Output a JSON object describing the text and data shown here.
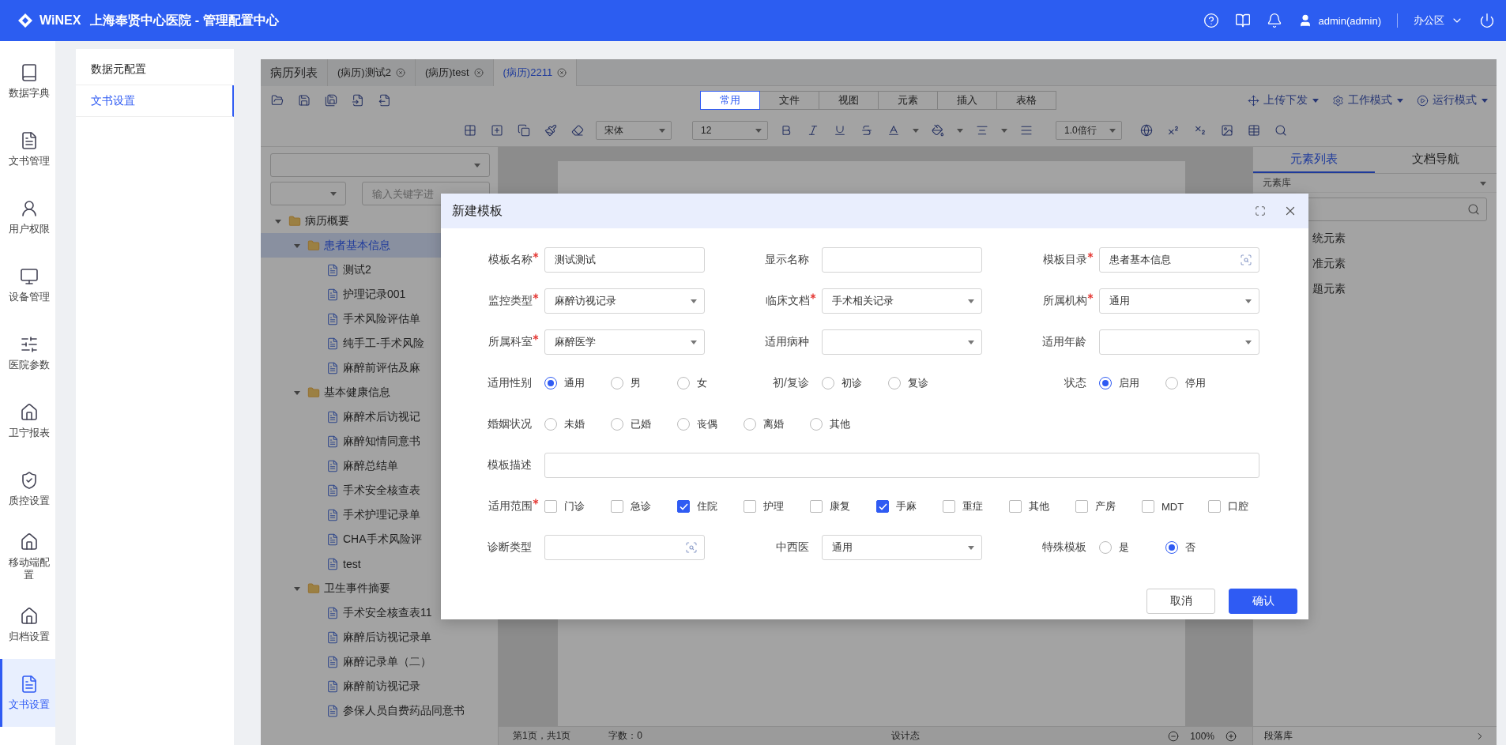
{
  "header": {
    "logo": "WiNEX",
    "title": "上海奉贤中心医院 - 管理配置中心",
    "user": "admin(admin)",
    "workspace": "办公区"
  },
  "rail": [
    {
      "label": "数据字典",
      "kind": "book",
      "selected": false
    },
    {
      "label": "文书管理",
      "kind": "file",
      "selected": false
    },
    {
      "label": "用户权限",
      "kind": "user",
      "selected": false
    },
    {
      "label": "设备管理",
      "kind": "monitor",
      "selected": false
    },
    {
      "label": "医院参数",
      "kind": "sliders",
      "selected": false
    },
    {
      "label": "卫宁报表",
      "kind": "house",
      "selected": false
    },
    {
      "label": "质控设置",
      "kind": "shield",
      "selected": false
    },
    {
      "label": "移动端配置",
      "kind": "house",
      "selected": false
    },
    {
      "label": "归档设置",
      "kind": "house",
      "selected": false
    },
    {
      "label": "文书设置",
      "kind": "file",
      "selected": true
    }
  ],
  "submenu": [
    {
      "label": "数据元配置",
      "selected": false
    },
    {
      "label": "文书设置",
      "selected": true
    }
  ],
  "doc_tabs": [
    {
      "label": "病历列表",
      "closable": false,
      "selected": false
    },
    {
      "label": "(病历)测试2",
      "closable": true,
      "selected": false
    },
    {
      "label": "(病历)test",
      "closable": true,
      "selected": false
    },
    {
      "label": "(病历)2211",
      "closable": true,
      "selected": true
    }
  ],
  "ribbon_tabs": [
    {
      "label": "常用",
      "selected": true
    },
    {
      "label": "文件",
      "selected": false
    },
    {
      "label": "视图",
      "selected": false
    },
    {
      "label": "元素",
      "selected": false
    },
    {
      "label": "插入",
      "selected": false
    },
    {
      "label": "表格",
      "selected": false
    }
  ],
  "ribbon_menus": [
    {
      "label": "上传下发",
      "kind": "move"
    },
    {
      "label": "工作模式",
      "kind": "gear"
    },
    {
      "label": "运行模式",
      "kind": "play"
    }
  ],
  "format": {
    "font": "宋体",
    "size": "12",
    "line_spacing": "1.0倍行"
  },
  "tree_filter": {
    "placeholder": "输入关键字进"
  },
  "tree": [
    {
      "label": "病历概要",
      "kind": "folder",
      "expanded": true,
      "selected": false,
      "children": [
        {
          "label": "患者基本信息",
          "kind": "folder",
          "expanded": true,
          "selected": true,
          "children": [
            {
              "label": "测试2",
              "kind": "document",
              "selected": false
            },
            {
              "label": "护理记录001",
              "kind": "document",
              "selected": false
            },
            {
              "label": "手术风险评估单",
              "kind": "document",
              "selected": false
            },
            {
              "label": "纯手工-手术风险",
              "kind": "document",
              "selected": false
            },
            {
              "label": "麻醉前评估及麻",
              "kind": "document",
              "selected": false
            }
          ]
        },
        {
          "label": "基本健康信息",
          "kind": "folder",
          "expanded": true,
          "selected": false,
          "children": [
            {
              "label": "麻醉术后访视记",
              "kind": "document",
              "selected": false
            },
            {
              "label": "麻醉知情同意书",
              "kind": "document",
              "selected": false
            },
            {
              "label": "麻醉总结单",
              "kind": "document",
              "selected": false
            },
            {
              "label": "手术安全核查表",
              "kind": "document",
              "selected": false
            },
            {
              "label": "手术护理记录单",
              "kind": "document",
              "selected": false
            },
            {
              "label": "CHA手术风险评",
              "kind": "document",
              "selected": false
            },
            {
              "label": "test",
              "kind": "document",
              "selected": false
            }
          ]
        },
        {
          "label": "卫生事件摘要",
          "kind": "folder",
          "expanded": true,
          "selected": false,
          "children": [
            {
              "label": "手术安全核查表11",
              "kind": "document",
              "selected": false
            },
            {
              "label": "麻醉后访视记录单",
              "kind": "document",
              "selected": false
            },
            {
              "label": "麻醉记录单（二）",
              "kind": "document",
              "selected": false
            },
            {
              "label": "麻醉前访视记录",
              "kind": "document",
              "selected": false
            },
            {
              "label": "参保人员自费药品同意书",
              "kind": "document",
              "selected": false
            }
          ]
        }
      ]
    }
  ],
  "side_tabs": [
    {
      "label": "元素列表",
      "selected": true
    },
    {
      "label": "文档导航",
      "selected": false
    }
  ],
  "element_library": "元素库",
  "elements": [
    "统元素",
    "准元素",
    "题元素"
  ],
  "status_bar": {
    "page": "第1页，共1页",
    "words": "字数：0",
    "mode": "设计态",
    "zoom": "100%",
    "paragraph_library": "段落库"
  },
  "dialog": {
    "title": "新建模板",
    "fields": [
      {
        "label": "模板名称",
        "kind": "text",
        "required": true,
        "value": "测试测试"
      },
      {
        "label": "显示名称",
        "kind": "text",
        "required": false
      },
      {
        "label": "模板目录",
        "kind": "lookup",
        "required": true,
        "value": "患者基本信息"
      },
      {
        "label": "监控类型",
        "kind": "select",
        "required": true,
        "value": "麻醉访视记录"
      },
      {
        "label": "临床文档",
        "kind": "select",
        "required": true,
        "value": "手术相关记录"
      },
      {
        "label": "所属机构",
        "kind": "select",
        "required": true,
        "value": "通用"
      },
      {
        "label": "所属科室",
        "kind": "select",
        "required": true,
        "value": "麻醉医学"
      },
      {
        "label": "适用病种",
        "kind": "select",
        "required": false
      },
      {
        "label": "适用年龄",
        "kind": "select",
        "required": false
      },
      {
        "label": "适用性别",
        "kind": "radio",
        "required": false,
        "options": [
          {
            "label": "通用",
            "selected": true
          },
          {
            "label": "男",
            "selected": false
          },
          {
            "label": "女",
            "selected": false
          }
        ]
      },
      {
        "label": "初/复诊",
        "kind": "radio",
        "required": false,
        "options": [
          {
            "label": "初诊",
            "selected": false
          },
          {
            "label": "复诊",
            "selected": false
          }
        ]
      },
      {
        "label": "状态",
        "kind": "radio",
        "required": false,
        "options": [
          {
            "label": "启用",
            "selected": true
          },
          {
            "label": "停用",
            "selected": false
          }
        ]
      },
      {
        "label": "婚姻状况",
        "kind": "radio",
        "required": false,
        "options": [
          {
            "label": "未婚",
            "selected": false
          },
          {
            "label": "已婚",
            "selected": false
          },
          {
            "label": "丧偶",
            "selected": false
          },
          {
            "label": "离婚",
            "selected": false
          },
          {
            "label": "其他",
            "selected": false
          }
        ]
      },
      {
        "label": "模板描述",
        "kind": "description",
        "required": false
      },
      {
        "label": "适用范围",
        "kind": "checkbox",
        "required": true,
        "options": [
          {
            "label": "门诊",
            "checked": false
          },
          {
            "label": "急诊",
            "checked": false
          },
          {
            "label": "住院",
            "checked": true
          },
          {
            "label": "护理",
            "checked": false
          },
          {
            "label": "康复",
            "checked": false
          },
          {
            "label": "手麻",
            "checked": true
          },
          {
            "label": "重症",
            "checked": false
          },
          {
            "label": "其他",
            "checked": false
          },
          {
            "label": "产房",
            "checked": false
          },
          {
            "label": "MDT",
            "checked": false
          },
          {
            "label": "口腔",
            "checked": false
          }
        ]
      },
      {
        "label": "诊断类型",
        "kind": "lookup",
        "required": false
      },
      {
        "label": "中西医",
        "kind": "select",
        "required": false,
        "value": "通用"
      },
      {
        "label": "特殊模板",
        "kind": "radio",
        "required": false,
        "options": [
          {
            "label": "是",
            "selected": false
          },
          {
            "label": "否",
            "selected": true
          }
        ]
      }
    ],
    "buttons": [
      {
        "label": "取消",
        "primary": false
      },
      {
        "label": "确认",
        "primary": true
      }
    ]
  }
}
